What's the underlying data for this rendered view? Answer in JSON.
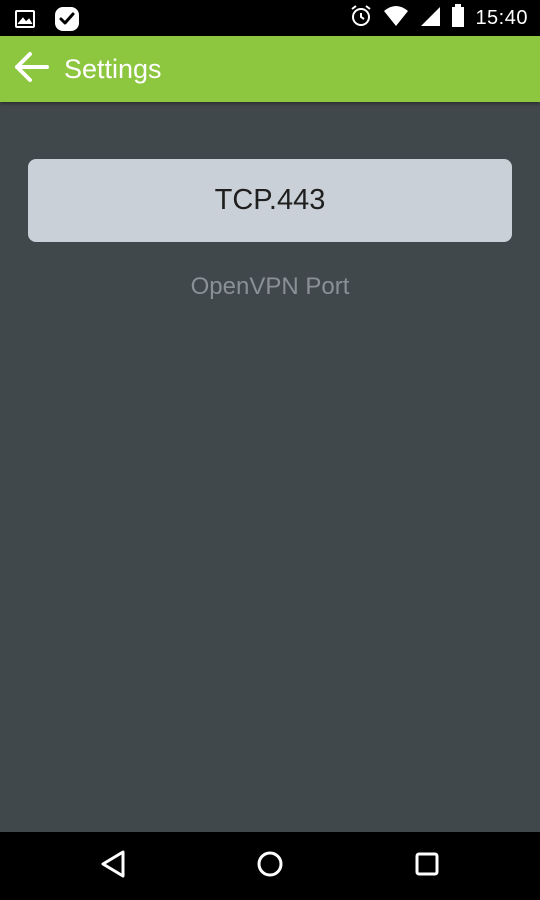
{
  "status_bar": {
    "time": "15:40",
    "icons": [
      "gallery-icon",
      "check-badge-icon",
      "alarm-icon",
      "wifi-icon",
      "signal-icon",
      "battery-icon"
    ]
  },
  "app_bar": {
    "title": "Settings",
    "background_color": "#8dc63f"
  },
  "content": {
    "port_value": "TCP.443",
    "port_label": "OpenVPN Port",
    "background_color": "#41484c",
    "button_color": "#cad0d7"
  },
  "nav_bar": {
    "buttons": [
      "back-triangle-icon",
      "home-circle-icon",
      "recents-square-icon"
    ]
  }
}
